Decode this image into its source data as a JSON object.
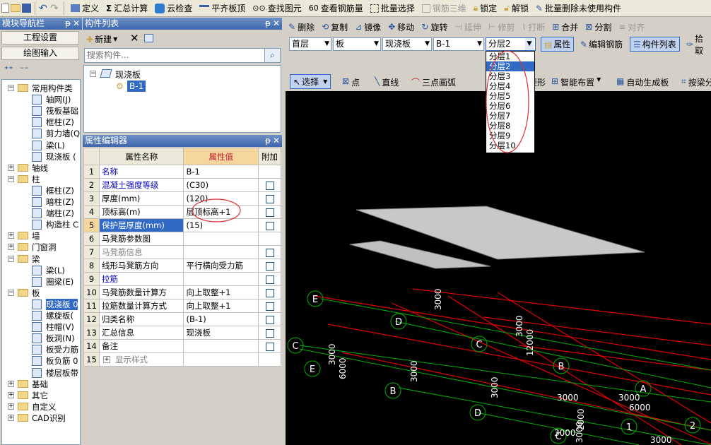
{
  "toolbar": {
    "define": "定义",
    "sum_calc": "汇总计算",
    "cloud_check": "云检查",
    "flat_slab_top": "平齐板顶",
    "find_elem": "查找图元",
    "view_rebar": "查看钢筋量",
    "batch_select": "批量选择",
    "rebar_3d": "钢筋三维",
    "lock": "锁定",
    "unlock": "解锁",
    "batch_delete": "批量删除未使用构件"
  },
  "nav_panel": {
    "title": "模块导航栏",
    "project_settings": "工程设置",
    "drawing_input": "绘图输入",
    "tree": [
      {
        "label": "常用构件类",
        "level": 0,
        "sign": "-"
      },
      {
        "label": "轴网(J)",
        "level": 1
      },
      {
        "label": "筏板基础",
        "level": 1
      },
      {
        "label": "框柱(Z)",
        "level": 1
      },
      {
        "label": "剪力墙(Q",
        "level": 1
      },
      {
        "label": "梁(L)",
        "level": 1
      },
      {
        "label": "现浇板 (",
        "level": 1
      },
      {
        "label": "轴线",
        "level": 0,
        "sign": "+"
      },
      {
        "label": "柱",
        "level": 0,
        "sign": "-"
      },
      {
        "label": "框柱(Z)",
        "level": 1
      },
      {
        "label": "暗柱(Z)",
        "level": 1
      },
      {
        "label": "端柱(Z)",
        "level": 1
      },
      {
        "label": "构造柱 C",
        "level": 1
      },
      {
        "label": "墙",
        "level": 0,
        "sign": "+"
      },
      {
        "label": "门窗洞",
        "level": 0,
        "sign": "+"
      },
      {
        "label": "梁",
        "level": 0,
        "sign": "-"
      },
      {
        "label": "梁(L)",
        "level": 1
      },
      {
        "label": "圈梁(E)",
        "level": 1
      },
      {
        "label": "板",
        "level": 0,
        "sign": "-"
      },
      {
        "label": "现浇板 0",
        "level": 1,
        "sel": true
      },
      {
        "label": "螺旋板(",
        "level": 1
      },
      {
        "label": "柱帽(V)",
        "level": 1
      },
      {
        "label": "板洞(N)",
        "level": 1
      },
      {
        "label": "板受力筋",
        "level": 1
      },
      {
        "label": "板负筋 0",
        "level": 1
      },
      {
        "label": "楼层板带",
        "level": 1
      },
      {
        "label": "基础",
        "level": 0,
        "sign": "+"
      },
      {
        "label": "其它",
        "level": 0,
        "sign": "+"
      },
      {
        "label": "自定义",
        "level": 0,
        "sign": "+"
      },
      {
        "label": "CAD识别",
        "level": 0,
        "sign": "+"
      }
    ]
  },
  "component_list": {
    "title": "构件列表",
    "new_label": "新建",
    "search_placeholder": "搜索构件...",
    "tree_root": "现浇板",
    "tree_child": "B-1"
  },
  "prop_editor": {
    "title": "属性编辑器",
    "col_name": "属性名称",
    "col_value": "属性值",
    "col_extra": "附加",
    "rows": [
      {
        "n": "1",
        "name": "名称",
        "value": "B-1",
        "blue": true,
        "chk": false
      },
      {
        "n": "2",
        "name": "混凝土强度等级",
        "value": "(C30)",
        "blue": true,
        "chk": true
      },
      {
        "n": "3",
        "name": "厚度(mm)",
        "value": "(120)",
        "chk": true
      },
      {
        "n": "4",
        "name": "顶标高(m)",
        "value": "层顶标高+1",
        "chk": true
      },
      {
        "n": "5",
        "name": "保护层厚度(mm)",
        "value": "(15)",
        "chk": true,
        "sel": true
      },
      {
        "n": "6",
        "name": "马凳筋参数图",
        "value": "",
        "chk": false
      },
      {
        "n": "7",
        "name": "马凳筋信息",
        "value": "",
        "gray": true,
        "chk": true
      },
      {
        "n": "8",
        "name": "线形马凳筋方向",
        "value": "平行横向受力筋",
        "chk": true
      },
      {
        "n": "9",
        "name": "拉筋",
        "value": "",
        "blue": true,
        "chk": true
      },
      {
        "n": "10",
        "name": "马凳筋数量计算方",
        "value": "向上取整+1",
        "chk": true
      },
      {
        "n": "11",
        "name": "拉筋数量计算方式",
        "value": "向上取整+1",
        "chk": true
      },
      {
        "n": "12",
        "name": "归类名称",
        "value": "(B-1)",
        "chk": true
      },
      {
        "n": "13",
        "name": "汇总信息",
        "value": "现浇板",
        "chk": true
      },
      {
        "n": "14",
        "name": "备注",
        "value": "",
        "chk": true
      },
      {
        "n": "15",
        "name": "显示样式",
        "value": "",
        "gray": true,
        "chk": false
      }
    ]
  },
  "edit_toolbar": {
    "delete": "删除",
    "copy": "复制",
    "mirror": "镜像",
    "move": "移动",
    "rotate": "旋转",
    "extend": "延伸",
    "trim": "修剪",
    "break": "打断",
    "merge": "合并",
    "split": "分割",
    "align": "对齐"
  },
  "selectors": {
    "floor": "首层",
    "type": "板",
    "subtype": "现浇板",
    "component": "B-1",
    "layer": "分层2",
    "properties": "属性",
    "edit_rebar": "编辑钢筋",
    "comp_list": "构件列表",
    "pick": "拾取"
  },
  "layer_options": [
    "分层1",
    "分层2",
    "分层3",
    "分层4",
    "分层5",
    "分层6",
    "分层7",
    "分层8",
    "分层9",
    "分层10"
  ],
  "draw_toolbar": {
    "select": "选择",
    "point": "点",
    "line": "直线",
    "arc3": "三点画弧",
    "rect": "矩形",
    "smart_place": "智能布置",
    "auto_gen": "自动生成板",
    "by_beam": "按梁分"
  },
  "canvas": {
    "axis_labels": [
      "E",
      "D",
      "C",
      "C",
      "B",
      "E",
      "B",
      "A",
      "D",
      "C",
      "1",
      "2"
    ],
    "dims": [
      "3000",
      "3000",
      "12000",
      "3000",
      "6000",
      "3000",
      "3000",
      "3000",
      "3000",
      "6000",
      "3000",
      "2000",
      "3000",
      "3000"
    ]
  },
  "colors": {
    "accent": "#316ac5",
    "title_bar": "#3d66ac",
    "grid_red": "#e00000",
    "grid_green": "#00c000",
    "slab": "#c0c0c0",
    "ellipse": "#e03030"
  }
}
